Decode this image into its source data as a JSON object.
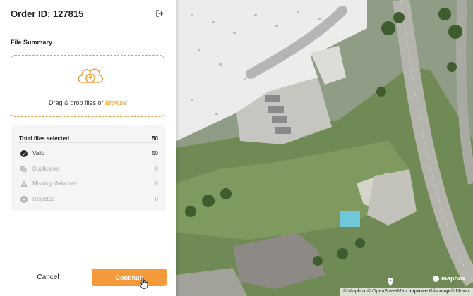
{
  "panel": {
    "title": "Order ID: 127815",
    "section_title": "File Summary",
    "upload": {
      "prompt": "Drag & drop files or ",
      "browse_link": "Browse"
    },
    "summary": {
      "total_label": "Total files selected",
      "total_value": "50",
      "rows": [
        {
          "label": "Valid",
          "value": "50",
          "icon": "check-circle-icon"
        },
        {
          "label": "Duplicates",
          "value": "0",
          "icon": "copy-icon"
        },
        {
          "label": "Missing Metadata",
          "value": "0",
          "icon": "warning-icon"
        },
        {
          "label": "Rejected",
          "value": "0",
          "icon": "x-circle-icon"
        }
      ]
    },
    "footer": {
      "cancel_label": "Cancel",
      "continue_label": "Continue"
    }
  },
  "map": {
    "logo_text": "mapbox",
    "attribution": {
      "mapbox": "© Mapbox",
      "osm": "© OpenStreetMap",
      "improve": "Improve this map",
      "maxar": "© Maxar"
    }
  },
  "colors": {
    "accent": "#f59a3a",
    "link": "#f29424",
    "dashed_border": "#f0a34a"
  }
}
